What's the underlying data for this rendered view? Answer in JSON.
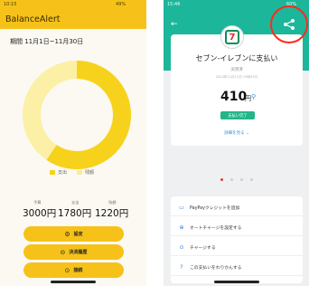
{
  "left": {
    "status_time": "10:15",
    "status_battery": "49%",
    "app_title": "BalanceAlert",
    "period": "期間 11月1日~11月30日",
    "chart_data": {
      "type": "pie",
      "categories": [
        "支出",
        "残額"
      ],
      "values": [
        1780,
        1220
      ],
      "colors": [
        "#f7d21c",
        "#fbf0a6"
      ]
    },
    "legend": [
      {
        "label": "支出",
        "color": "#f7d21c"
      },
      {
        "label": "残額",
        "color": "#f6ec9d"
      }
    ],
    "amounts": [
      {
        "caption": "予算",
        "value": "3000円"
      },
      {
        "caption": "支出",
        "value": "1780円"
      },
      {
        "caption": "残額",
        "value": "1220円"
      }
    ],
    "buttons": [
      {
        "icon": "gear-icon",
        "glyph": "⚙",
        "label": "設定"
      },
      {
        "icon": "history-icon",
        "glyph": "⊝",
        "label": "決済履歴"
      },
      {
        "icon": "clock-icon",
        "glyph": "⊙",
        "label": "接続"
      }
    ],
    "accent": "#f6c21a"
  },
  "right": {
    "status_time": "15:46",
    "status_battery": "60%",
    "header_color": "#1cb79a",
    "merchant_logo_text": "7",
    "title": "セブン-イレブンに支払い",
    "subtitle": "決済済",
    "datetime": "2024年11月12日 15時45分",
    "amount": "410",
    "currency": "円",
    "status_badge": "支払い完了",
    "detail_link": "詳細を見る",
    "carousel_dots": 4,
    "carousel_active": 0,
    "menu": [
      {
        "icon": "card-icon",
        "glyph": "▭",
        "label": "PayPayクレジットを追加"
      },
      {
        "icon": "auto-charge-icon",
        "glyph": "⊕",
        "label": "オートチャージを設定する"
      },
      {
        "icon": "charge-icon",
        "glyph": "⊙",
        "label": "チャージする"
      },
      {
        "icon": "help-icon",
        "glyph": "?",
        "label": "この支払いをわりかんする"
      }
    ],
    "highlight_color": "#ff2a1a"
  }
}
